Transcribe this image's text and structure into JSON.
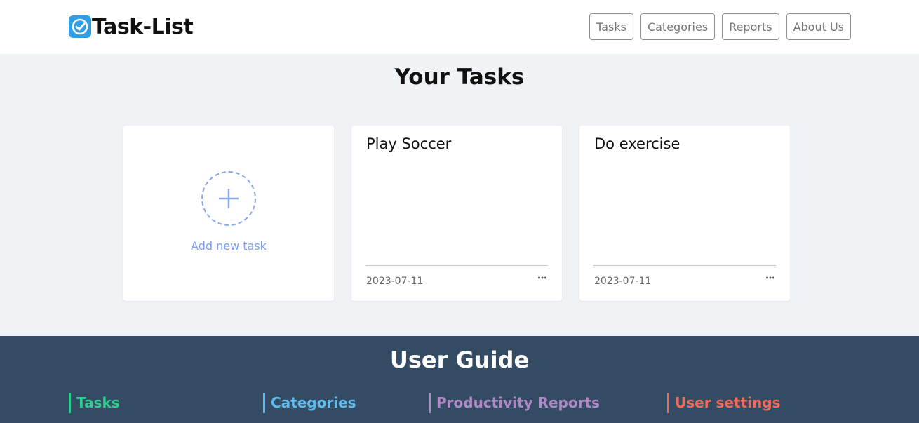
{
  "header": {
    "brand_title": "Task-List",
    "brand_icon": "checkmark-icon",
    "nav": [
      {
        "label": "Tasks"
      },
      {
        "label": "Categories"
      },
      {
        "label": "Reports"
      },
      {
        "label": "About Us"
      }
    ]
  },
  "main": {
    "title": "Your Tasks",
    "add_card": {
      "label": "Add new task",
      "icon": "plus-icon"
    },
    "tasks": [
      {
        "title": "Play Soccer",
        "date": "2023-07-11"
      },
      {
        "title": "Do exercise",
        "date": "2023-07-11"
      }
    ]
  },
  "footer": {
    "title": "User Guide",
    "items": [
      {
        "label": "Tasks",
        "color": "#2ecc8e"
      },
      {
        "label": "Categories",
        "color": "#5dbcf0"
      },
      {
        "label": "Productivity Reports",
        "color": "#b088c6"
      },
      {
        "label": "User settings",
        "color": "#ef6b5c"
      }
    ]
  },
  "colors": {
    "brand": "#2f9ee6",
    "accent": "#7c9ef0",
    "footer_bg": "#334c63",
    "page_bg": "#f0f3f6"
  }
}
